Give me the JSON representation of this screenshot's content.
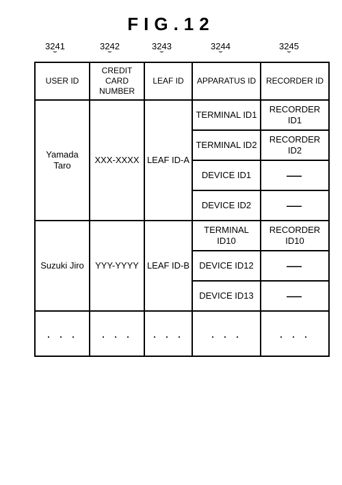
{
  "figure_title": "FIG.12",
  "column_refs": [
    "3241",
    "3242",
    "3243",
    "3244",
    "3245"
  ],
  "headers": {
    "user_id": "USER ID",
    "credit_card": "CREDIT CARD NUMBER",
    "leaf_id": "LEAF ID",
    "apparatus_id": "APPARATUS ID",
    "recorder_id": "RECORDER ID"
  },
  "groups": [
    {
      "user_id": "Yamada Taro",
      "credit_card": "XXX-XXXX",
      "leaf_id": "LEAF ID-A",
      "rows": [
        {
          "apparatus_id": "TERMINAL ID1",
          "recorder_id": "RECORDER ID1"
        },
        {
          "apparatus_id": "TERMINAL ID2",
          "recorder_id": "RECORDER ID2"
        },
        {
          "apparatus_id": "DEVICE ID1",
          "recorder_id": "—"
        },
        {
          "apparatus_id": "DEVICE ID2",
          "recorder_id": "—"
        }
      ]
    },
    {
      "user_id": "Suzuki Jiro",
      "credit_card": "YYY-YYYY",
      "leaf_id": "LEAF ID-B",
      "rows": [
        {
          "apparatus_id": "TERMINAL ID10",
          "recorder_id": "RECORDER ID10"
        },
        {
          "apparatus_id": "DEVICE ID12",
          "recorder_id": "—"
        },
        {
          "apparatus_id": "DEVICE ID13",
          "recorder_id": "—"
        }
      ]
    }
  ],
  "ellipsis": ". . .",
  "chart_data": {
    "type": "table",
    "title": "FIG.12",
    "columns": [
      "USER ID",
      "CREDIT CARD NUMBER",
      "LEAF ID",
      "APPARATUS ID",
      "RECORDER ID"
    ],
    "column_refs": [
      "3241",
      "3242",
      "3243",
      "3244",
      "3245"
    ],
    "rows": [
      [
        "Yamada Taro",
        "XXX-XXXX",
        "LEAF ID-A",
        "TERMINAL ID1",
        "RECORDER ID1"
      ],
      [
        "Yamada Taro",
        "XXX-XXXX",
        "LEAF ID-A",
        "TERMINAL ID2",
        "RECORDER ID2"
      ],
      [
        "Yamada Taro",
        "XXX-XXXX",
        "LEAF ID-A",
        "DEVICE ID1",
        "—"
      ],
      [
        "Yamada Taro",
        "XXX-XXXX",
        "LEAF ID-A",
        "DEVICE ID2",
        "—"
      ],
      [
        "Suzuki Jiro",
        "YYY-YYYY",
        "LEAF ID-B",
        "TERMINAL ID10",
        "RECORDER ID10"
      ],
      [
        "Suzuki Jiro",
        "YYY-YYYY",
        "LEAF ID-B",
        "DEVICE ID12",
        "—"
      ],
      [
        "Suzuki Jiro",
        "YYY-YYYY",
        "LEAF ID-B",
        "DEVICE ID13",
        "—"
      ],
      [
        ". . .",
        ". . .",
        ". . .",
        ". . .",
        ". . ."
      ]
    ]
  }
}
